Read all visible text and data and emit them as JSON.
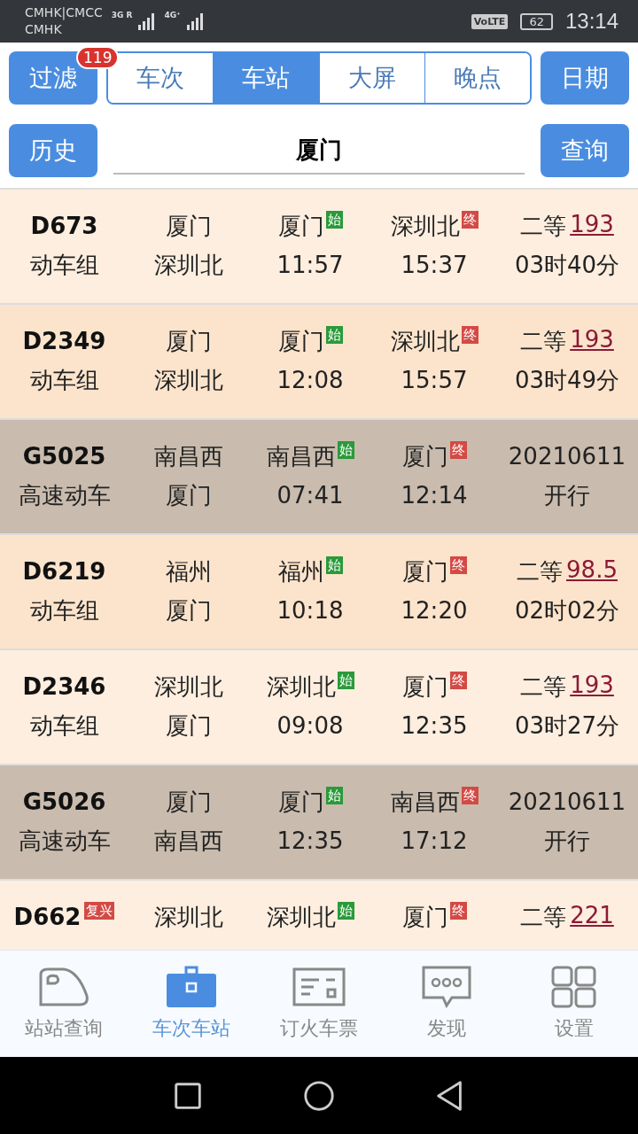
{
  "status_bar": {
    "carrier_1": "CMHK|CMCC",
    "carrier_2": "CMHK",
    "net_1": "3G R",
    "net_2": "4G⁺",
    "volte": "VoLTE",
    "battery": "62",
    "time": "13:14"
  },
  "toolbar": {
    "filter_button": "过滤",
    "filter_count": "119",
    "date_button": "日期",
    "history_button": "历史",
    "query_button": "查询",
    "tabs": [
      {
        "label": "车次",
        "selected": false
      },
      {
        "label": "车站",
        "selected": true
      },
      {
        "label": "大屏",
        "selected": false
      },
      {
        "label": "晚点",
        "selected": false
      }
    ],
    "station_field": "厦门"
  },
  "rows": [
    {
      "kind": "fare",
      "color": "#fdeedf",
      "train": "D673",
      "type": "动车组",
      "from": "厦门",
      "to": "深圳北",
      "dep_station": "厦门",
      "start_badge": "始",
      "dep_time": "11:57",
      "arr_station": "深圳北",
      "end_badge": "终",
      "arr_time": "15:37",
      "seat": "二等",
      "price": "193",
      "duration": "03时40分"
    },
    {
      "kind": "fare",
      "color": "#fce4cc",
      "train": "D2349",
      "type": "动车组",
      "from": "厦门",
      "to": "深圳北",
      "dep_station": "厦门",
      "start_badge": "始",
      "dep_time": "12:08",
      "arr_station": "深圳北",
      "end_badge": "终",
      "arr_time": "15:57",
      "seat": "二等",
      "price": "193",
      "duration": "03时49分"
    },
    {
      "kind": "date",
      "color": "#c9bcae",
      "train": "G5025",
      "type": "高速动车",
      "from": "南昌西",
      "to": "厦门",
      "dep_station": "南昌西",
      "start_badge": "始",
      "dep_time": "07:41",
      "arr_station": "厦门",
      "end_badge": "终",
      "arr_time": "12:14",
      "date": "20210611",
      "note": "开行"
    },
    {
      "kind": "fare",
      "color": "#fce4cc",
      "train": "D6219",
      "type": "动车组",
      "from": "福州",
      "to": "厦门",
      "dep_station": "福州",
      "start_badge": "始",
      "dep_time": "10:18",
      "arr_station": "厦门",
      "end_badge": "终",
      "arr_time": "12:20",
      "seat": "二等",
      "price": "98.5",
      "duration": "02时02分"
    },
    {
      "kind": "fare",
      "color": "#fdeedf",
      "train": "D2346",
      "type": "动车组",
      "from": "深圳北",
      "to": "厦门",
      "dep_station": "深圳北",
      "start_badge": "始",
      "dep_time": "09:08",
      "arr_station": "厦门",
      "end_badge": "终",
      "arr_time": "12:35",
      "seat": "二等",
      "price": "193",
      "duration": "03时27分"
    },
    {
      "kind": "date",
      "color": "#c9bcae",
      "train": "G5026",
      "type": "高速动车",
      "from": "厦门",
      "to": "南昌西",
      "dep_station": "厦门",
      "start_badge": "始",
      "dep_time": "12:35",
      "arr_station": "南昌西",
      "end_badge": "终",
      "arr_time": "17:12",
      "date": "20210611",
      "note": "开行"
    },
    {
      "kind": "fare",
      "color": "#fdeedf",
      "train": "D662",
      "train_badge": "复兴",
      "from": "深圳北",
      "dep_station": "深圳北",
      "start_badge": "始",
      "arr_station": "厦门",
      "end_badge": "终",
      "seat": "二等",
      "price": "221"
    }
  ],
  "bottom_nav": [
    {
      "label": "站站查询",
      "kind": "train",
      "selected": false
    },
    {
      "label": "车次车站",
      "kind": "briefcase",
      "selected": true
    },
    {
      "label": "订火车票",
      "kind": "ticket",
      "selected": false
    },
    {
      "label": "发现",
      "kind": "chat",
      "selected": false
    },
    {
      "label": "设置",
      "kind": "grid",
      "selected": false
    }
  ]
}
